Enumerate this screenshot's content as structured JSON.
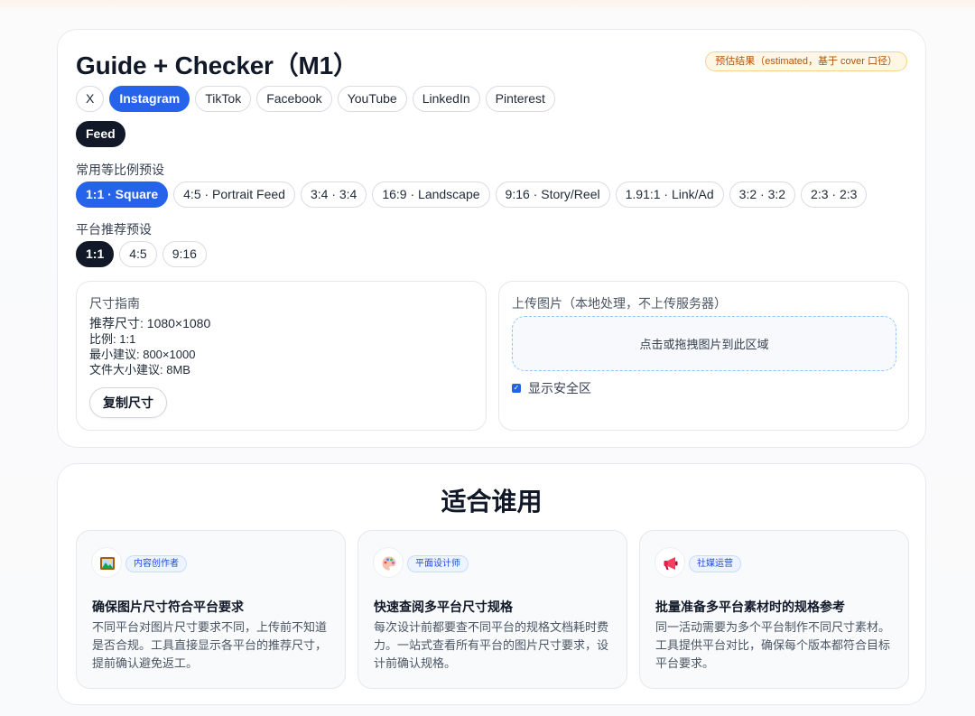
{
  "checker": {
    "title": "Guide + Checker（M1）",
    "estimate_badge": "预估结果（estimated，基于 cover 口径）",
    "platforms": [
      {
        "label": "X",
        "active": false
      },
      {
        "label": "Instagram",
        "active": true
      },
      {
        "label": "TikTok",
        "active": false
      },
      {
        "label": "Facebook",
        "active": false
      },
      {
        "label": "YouTube",
        "active": false
      },
      {
        "label": "LinkedIn",
        "active": false
      },
      {
        "label": "Pinterest",
        "active": false
      }
    ],
    "placement": {
      "label": "Feed",
      "active": true
    },
    "common_presets_label": "常用等比例预设",
    "common_presets": [
      {
        "label": "1:1 · Square",
        "active": true
      },
      {
        "label": "4:5 · Portrait Feed",
        "active": false
      },
      {
        "label": "3:4 · 3:4",
        "active": false
      },
      {
        "label": "16:9 · Landscape",
        "active": false
      },
      {
        "label": "9:16 · Story/Reel",
        "active": false
      },
      {
        "label": "1.91:1 · Link/Ad",
        "active": false
      },
      {
        "label": "3:2 · 3:2",
        "active": false
      },
      {
        "label": "2:3 · 2:3",
        "active": false
      }
    ],
    "platform_presets_label": "平台推荐预设",
    "platform_presets": [
      {
        "label": "1:1",
        "active": true
      },
      {
        "label": "4:5",
        "active": false
      },
      {
        "label": "9:16",
        "active": false
      }
    ],
    "guide": {
      "heading": "尺寸指南",
      "recommended": "推荐尺寸: 1080×1080",
      "ratio": "比例: 1:1",
      "minimum": "最小建议: 800×1000",
      "filesize": "文件大小建议: 8MB",
      "copy_button": "复制尺寸"
    },
    "upload": {
      "heading": "上传图片（本地处理，不上传服务器）",
      "dropzone": "点击或拖拽图片到此区域",
      "safe_zone_label": "显示安全区",
      "safe_zone_checked": true
    }
  },
  "audience": {
    "title": "适合谁用",
    "personas": [
      {
        "icon": "framed-picture-icon",
        "tag": "内容创作者",
        "title": "确保图片尺寸符合平台要求",
        "desc": "不同平台对图片尺寸要求不同，上传前不知道是否合规。工具直接显示各平台的推荐尺寸，提前确认避免返工。"
      },
      {
        "icon": "palette-icon",
        "tag": "平面设计师",
        "title": "快速查阅多平台尺寸规格",
        "desc": "每次设计前都要查不同平台的规格文档耗时费力。一站式查看所有平台的图片尺寸要求，设计前确认规格。"
      },
      {
        "icon": "megaphone-icon",
        "tag": "社媒运营",
        "title": "批量准备多平台素材时的规格参考",
        "desc": "同一活动需要为多个平台制作不同尺寸素材。工具提供平台对比，确保每个版本都符合目标平台要求。"
      }
    ]
  },
  "colors": {
    "primary": "#2563eb",
    "dark": "#111827",
    "badge_bg": "#fef7e4",
    "badge_text": "#b45309"
  }
}
